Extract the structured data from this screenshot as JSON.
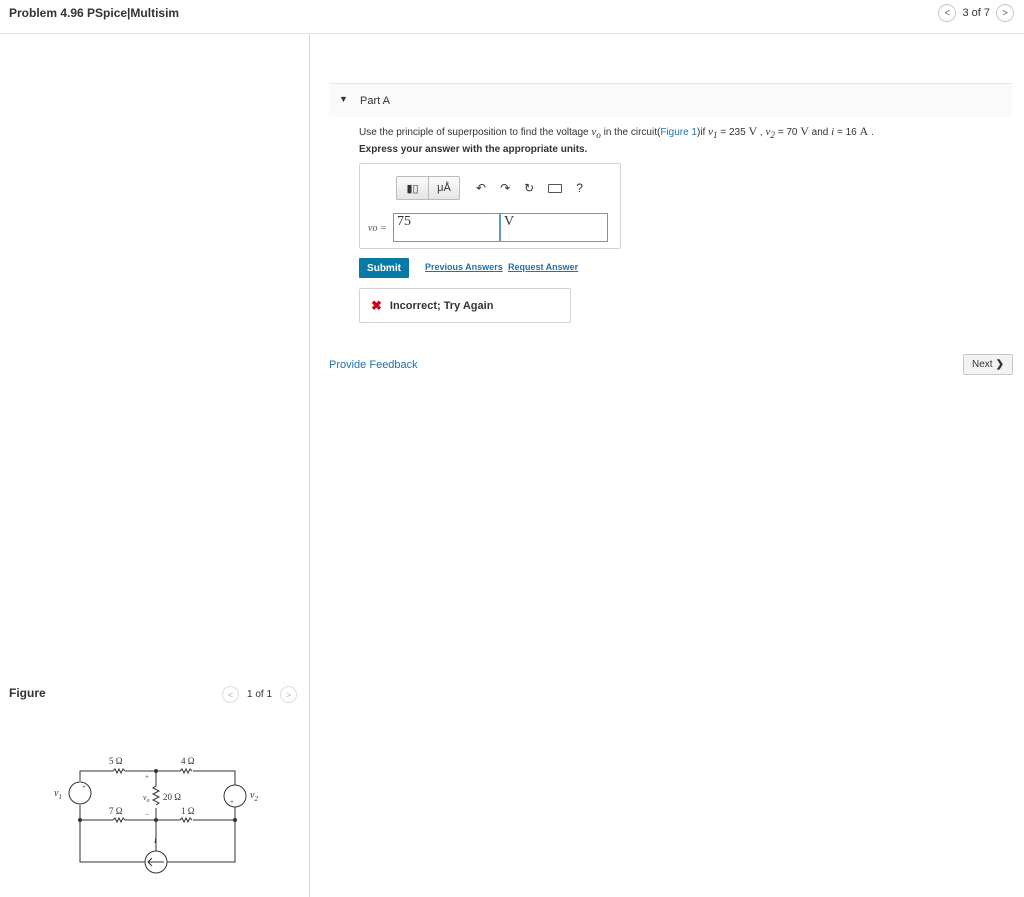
{
  "header": {
    "problem_title": "Problem 4.96 PSpice|Multisim",
    "pager_text": "3 of 7",
    "prev_glyph": "<",
    "next_glyph": ">"
  },
  "part": {
    "caret": "▼",
    "title": "Part A"
  },
  "question": {
    "text1": "Use the principle of superposition to find the voltage ",
    "var_vo": "v",
    "var_vo_sub": "o",
    "text2": " in the circuit(",
    "figure_link": "Figure 1",
    "text3": ")if ",
    "v1": "v",
    "v1_sub": "1",
    "eq1": " = 235 ",
    "unit1": "V",
    "sep1": " , ",
    "v2": "v",
    "v2_sub": "2",
    "eq2": " = 70 ",
    "unit2": "V",
    "sep2": " and ",
    "i_var": "i",
    "eq3": " = 16 ",
    "unit3": "A",
    "end": " .",
    "express": "Express your answer with the appropriate units."
  },
  "answer": {
    "template_icon1": "▮▯",
    "template_icon2": "μÅ",
    "undo": "↶",
    "redo": "↷",
    "reset": "↻",
    "help": "?",
    "var_label": "vo =",
    "value": "75",
    "unit": "V"
  },
  "actions": {
    "submit": "Submit",
    "previous_answers": "Previous Answers",
    "request_answer": "Request Answer"
  },
  "feedback": {
    "icon": "✖",
    "text": "Incorrect; Try Again"
  },
  "footer": {
    "provide_feedback": "Provide Feedback",
    "next": "Next",
    "next_chevron": "❯"
  },
  "figure": {
    "label": "Figure",
    "pager_text": "1 of 1",
    "prev_glyph": "<",
    "next_glyph": ">",
    "circuit_labels": {
      "r1": "5 Ω",
      "r2": "4 Ω",
      "r3": "20 Ω",
      "r4": "7 Ω",
      "r5": "1 Ω",
      "v1": "v",
      "v1_sub": "1",
      "v2": "v",
      "v2_sub": "2",
      "vo": "v",
      "vo_sub": "o",
      "i": "i",
      "plus": "+",
      "minus": "−"
    }
  }
}
